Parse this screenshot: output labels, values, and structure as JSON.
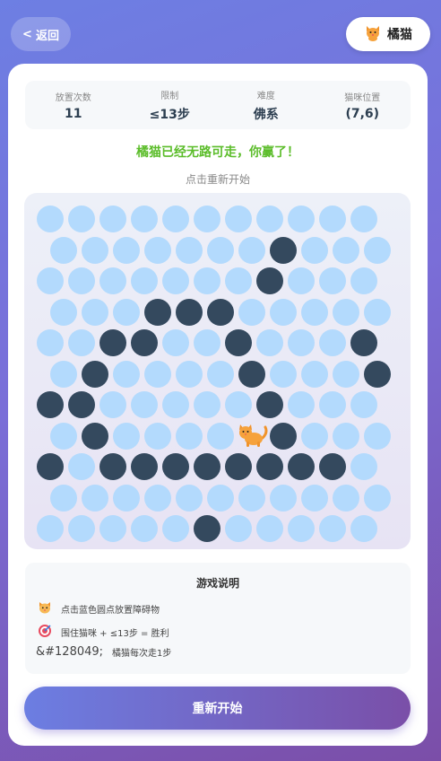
{
  "header": {
    "back_label": "返回",
    "cat_name": "橘猫"
  },
  "stats": [
    {
      "label": "放置次数",
      "value": "11"
    },
    {
      "label": "限制",
      "value": "≤13步"
    },
    {
      "label": "难度",
      "value": "佛系"
    },
    {
      "label": "猫咪位置",
      "value": "(7,6)"
    }
  ],
  "status": {
    "message": "橘猫已经无路可走，你赢了！",
    "hint": "点击重新开始"
  },
  "board": {
    "rows": 11,
    "cols": 11,
    "cat_position": [
      7,
      6
    ],
    "blocked": [
      [
        1,
        7
      ],
      [
        2,
        7
      ],
      [
        3,
        3
      ],
      [
        3,
        4
      ],
      [
        3,
        5
      ],
      [
        4,
        2
      ],
      [
        4,
        3
      ],
      [
        4,
        6
      ],
      [
        4,
        10
      ],
      [
        5,
        1
      ],
      [
        5,
        6
      ],
      [
        5,
        10
      ],
      [
        6,
        0
      ],
      [
        6,
        1
      ],
      [
        6,
        7
      ],
      [
        7,
        1
      ],
      [
        7,
        7
      ],
      [
        8,
        0
      ],
      [
        8,
        2
      ],
      [
        8,
        3
      ],
      [
        8,
        4
      ],
      [
        8,
        5
      ],
      [
        8,
        6
      ],
      [
        8,
        7
      ],
      [
        8,
        8
      ],
      [
        8,
        9
      ],
      [
        10,
        5
      ]
    ],
    "colors": {
      "open": "#b3dafd",
      "blocked": "#34495e"
    }
  },
  "rules": {
    "title": "游戏说明",
    "items": [
      {
        "icon": "cat-face-icon",
        "text": "点击蓝色圆点放置障碍物"
      },
      {
        "icon": "target-icon",
        "text": "围住猫咪 + ≤13步 = 胜利"
      },
      {
        "icon_raw": "&#128049;",
        "text": "橘猫每次走1步"
      }
    ]
  },
  "restart_label": "重新开始"
}
